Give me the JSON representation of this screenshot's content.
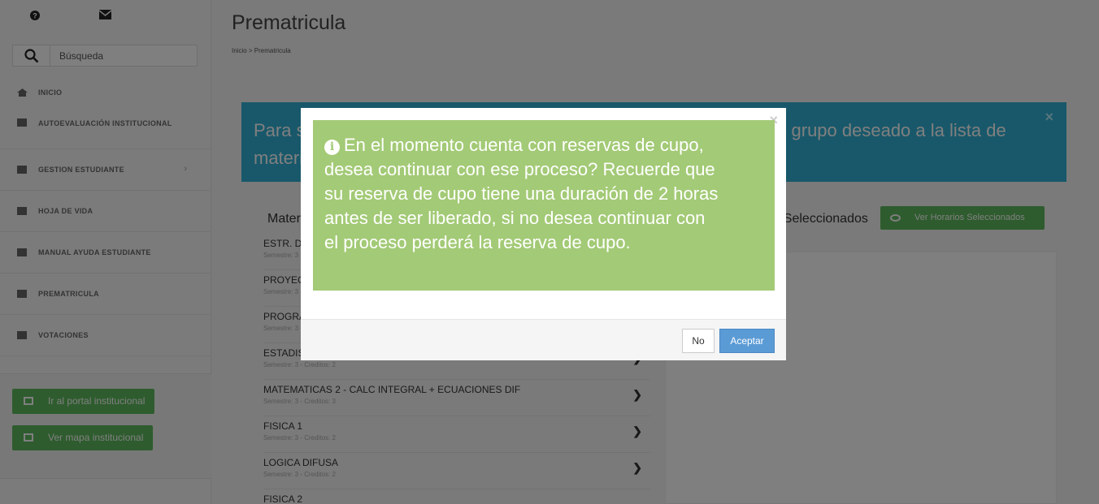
{
  "sidebar": {
    "search_placeholder": "Búsqueda",
    "items": [
      {
        "label": "INICIO",
        "icon": "home-icon"
      },
      {
        "label": "AUTOEVALUACIÓN INSTITUCIONAL",
        "icon": "list-icon"
      },
      {
        "label": "GESTION ESTUDIANTE",
        "icon": "list-icon",
        "chevron": "›"
      },
      {
        "label": "HOJA DE VIDA",
        "icon": "list-icon"
      },
      {
        "label": "MANUAL AYUDA ESTUDIANTE",
        "icon": "list-icon"
      },
      {
        "label": "PREMATRICULA",
        "icon": "list-icon"
      },
      {
        "label": "VOTACIONES",
        "icon": "list-icon"
      }
    ],
    "buttons": [
      {
        "label": "Ir al portal institucional",
        "icon": "monitor-icon"
      },
      {
        "label": "Ver mapa institucional",
        "icon": "map-icon"
      }
    ]
  },
  "main": {
    "title": "Prematricula",
    "breadcrumb": "Inicio  >  Prematricula",
    "alert": "Para seleccionar sus materias, de click en una materia y arrastre el grupo deseado a la lista de materias seleccionadas o use el boton selecionar.",
    "left_panel_title": "Materias",
    "right_panel_title": "Materias Seleccionados",
    "ver_horarios_label": "Ver Horarios Seleccionados",
    "subjects": [
      {
        "name": "ESTR. DE DATOS",
        "meta": "Semestre: 3 - Creditos: 3"
      },
      {
        "name": "PROYECTO INTEGRADOR",
        "meta": "Semestre: 3 - Creditos: 2"
      },
      {
        "name": "PROGRAMACION",
        "meta": "Semestre: 3 - Creditos: 3"
      },
      {
        "name": "ESTADISTICA",
        "meta": "Semestre: 3 - Creditos: 2"
      },
      {
        "name": "MATEMATICAS 2 - CALC INTEGRAL + ECUACIONES DIF",
        "meta": "Semestre: 3 - Creditos: 3"
      },
      {
        "name": "FISICA 1",
        "meta": "Semestre: 3 - Creditos: 2"
      },
      {
        "name": "LOGICA DIFUSA",
        "meta": "Semestre: 3 - Creditos: 2"
      },
      {
        "name": "FISICA 2",
        "meta": ""
      }
    ]
  },
  "modal": {
    "message": "En el momento cuenta con reservas de cupo, desea continuar con ese proceso? Recuerde que su reserva de cupo tiene una duración de 2 horas antes de ser liberado, si no desea continuar con el proceso perderá la reserva de cupo.",
    "no_label": "No",
    "ok_label": "Aceptar",
    "close_glyph": "×",
    "info_glyph": "i",
    "message_color": "#a3ca76"
  },
  "colors": {
    "alert_info": "#31b0d5",
    "success": "#5cb85c",
    "primary": "#5b9bd5"
  }
}
